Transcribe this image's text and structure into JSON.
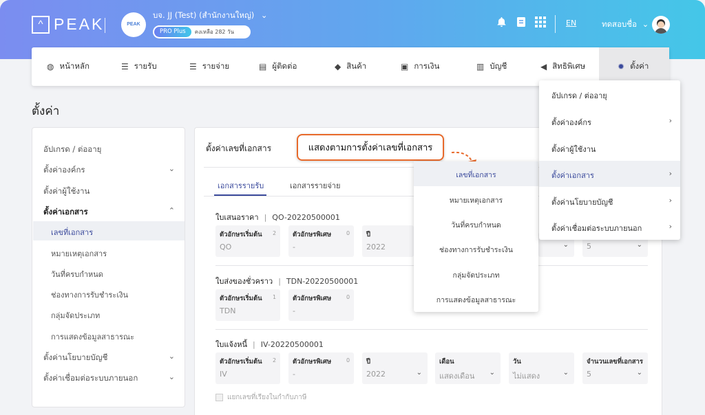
{
  "header": {
    "logo_text": "PEAK",
    "org_avatar_text": "PEAK",
    "org_name": "บจ. JJ (Test) (สำนักงานใหญ่)",
    "plan": "PRO Plus",
    "remaining": "คงเหลือ 282 วัน",
    "lang": "EN",
    "user_name": "ทดสอบชื่อ"
  },
  "nav": [
    {
      "label": "หน้าหลัก",
      "icon": "dashboard-icon"
    },
    {
      "label": "รายรับ",
      "icon": "income-list-icon"
    },
    {
      "label": "รายจ่าย",
      "icon": "expense-list-icon"
    },
    {
      "label": "ผู้ติดต่อ",
      "icon": "contact-book-icon"
    },
    {
      "label": "สินค้า",
      "icon": "box-icon"
    },
    {
      "label": "การเงิน",
      "icon": "money-icon"
    },
    {
      "label": "บัญชี",
      "icon": "book-icon"
    },
    {
      "label": "สิทธิพิเศษ",
      "icon": "megaphone-icon"
    },
    {
      "label": "ตั้งค่า",
      "icon": "gear-icon"
    }
  ],
  "page_title": "ตั้งค่า",
  "sidebar": {
    "upgrade": "อัปเกรด / ต่ออายุ",
    "org": "ตั้งค่าองค์กร",
    "user": "ตั้งค่าผู้ใช้งาน",
    "docs": "ตั้งค่าเอกสาร",
    "docs_items": [
      "เลขที่เอกสาร",
      "หมายเหตุเอกสาร",
      "วันที่ครบกำหนด",
      "ช่องทางการรับชำระเงิน",
      "กลุ่มจัดประเภท",
      "การแสดงข้อมูลสาธารณะ"
    ],
    "policy": "ตั้งค่านโยบายบัญชี",
    "external": "ตั้งค่าเชื่อมต่อระบบภายนอก"
  },
  "main": {
    "title": "ตั้งค่าเลขที่เอกสาร",
    "callout": "แสดงตามการตั้งค่าเลขที่เอกสาร",
    "tabs": [
      "เอกสารรายรับ",
      "เอกสารรายจ่าย"
    ],
    "sections": [
      {
        "name": "ใบเสนอราคา",
        "code": "QO-20220500001",
        "prefix": "QO",
        "prefix_count": "2",
        "special": "-",
        "special_count": "0",
        "year": "2022",
        "count": "5"
      },
      {
        "name": "ใบส่งของชั่วคราว",
        "code": "TDN-20220500001",
        "prefix": "TDN",
        "prefix_count": "1",
        "special": "-",
        "special_count": "0"
      },
      {
        "name": "ใบแจ้งหนี้",
        "code": "IV-20220500001",
        "prefix": "IV",
        "prefix_count": "2",
        "special": "-",
        "special_count": "0",
        "year": "2022",
        "month": "แสดงเดือน",
        "day": "ไม่แสดง",
        "count": "5"
      }
    ],
    "labels": {
      "prefix": "ตัวอักษรเริ่มต้น",
      "special": "ตัวอักษรพิเศษ",
      "year": "ปี",
      "month": "เดือน",
      "day": "วัน",
      "count": "จำนวนเลขที่เอกสาร"
    },
    "checkbox": "แยกเลขที่เรียงในกำกับภาษี"
  },
  "submenu": [
    "เลขที่เอกสาร",
    "หมายเหตุเอกสาร",
    "วันที่ครบกำหนด",
    "ช่องทางการรับชำระเงิน",
    "กลุ่มจัดประเภท",
    "การแสดงข้อมูลสาธารณะ"
  ],
  "dropdown": [
    "อัปเกรด / ต่ออายุ",
    "ตั้งค่าองค์กร",
    "ตั้งค่าผู้ใช้งาน",
    "ตั้งค่าเอกสาร",
    "ตั้งค่านโยบายบัญชี",
    "ตั้งค่าเชื่อมต่อระบบภายนอก"
  ],
  "colors": {
    "accent": "#3b4a9c",
    "callout_border": "#e8692a",
    "header_start": "#7b8df0",
    "header_end": "#44c7e8"
  }
}
